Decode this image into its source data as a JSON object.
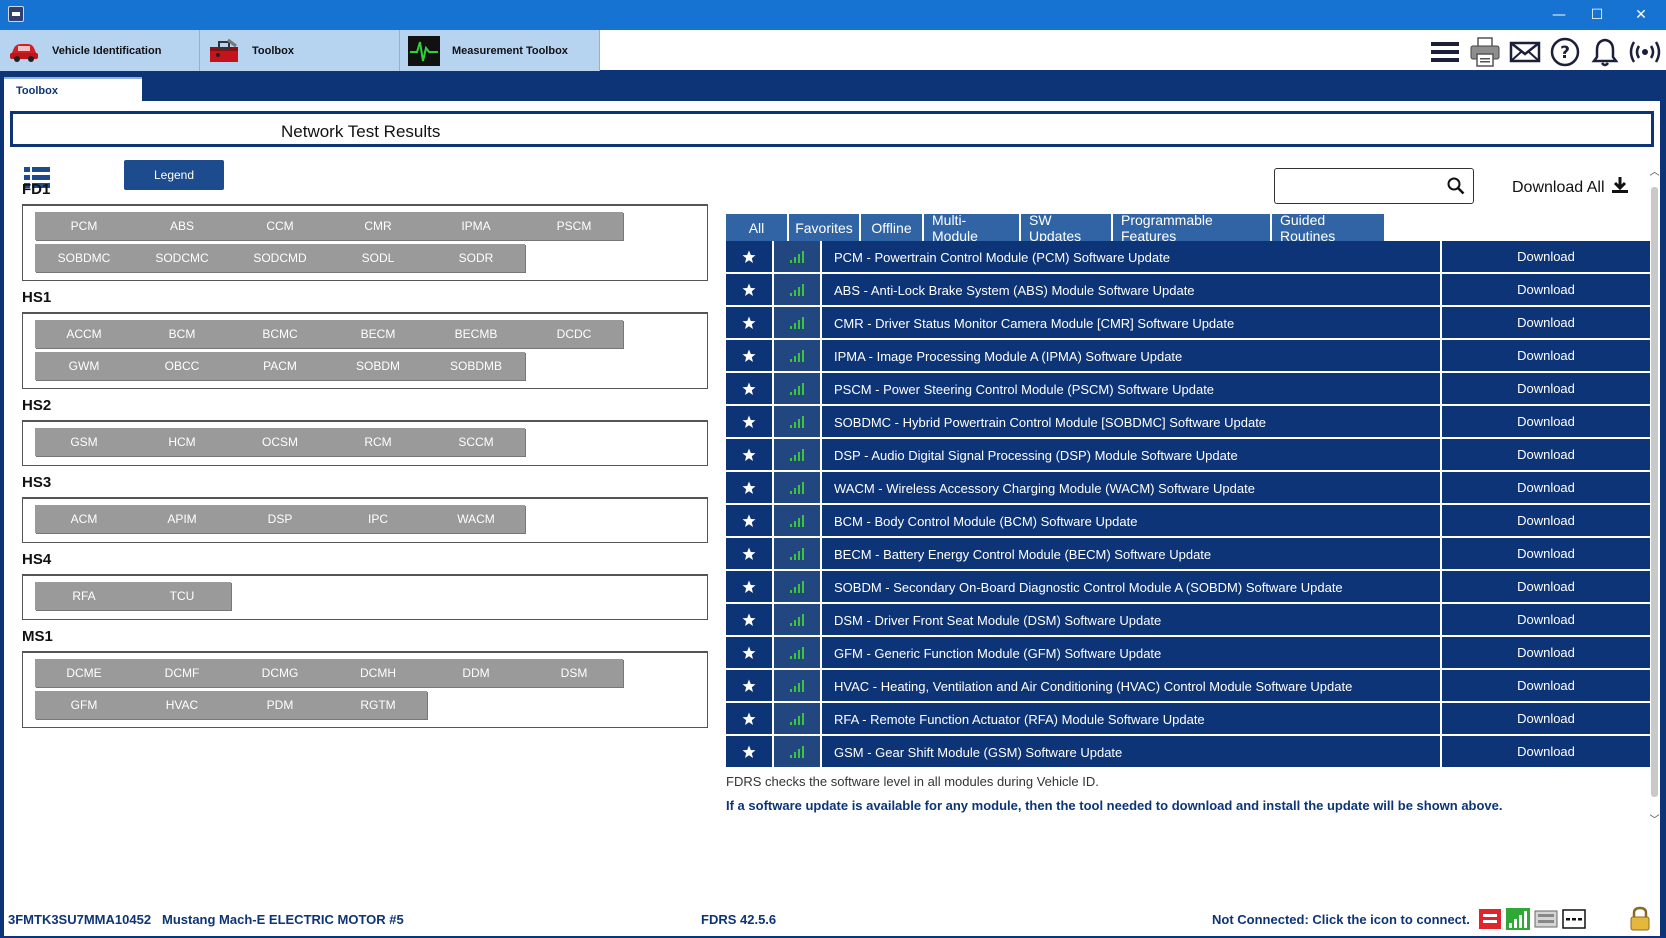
{
  "window": {
    "minimize": "—",
    "maximize": "☐",
    "close": "✕"
  },
  "app_tabs": [
    {
      "label": "Vehicle Identification",
      "icon": "car-icon"
    },
    {
      "label": "Toolbox",
      "icon": "toolbox-icon"
    },
    {
      "label": "Measurement Toolbox",
      "icon": "oscilloscope-icon"
    }
  ],
  "toolbar_icons": [
    "menu-icon",
    "printer-icon",
    "mail-icon",
    "help-icon",
    "bell-icon",
    "wireless-icon"
  ],
  "sub_tab": "Toolbox",
  "page_title": "Network Test Results",
  "legend_label": "Legend",
  "buses": [
    {
      "name": "FD1",
      "modules": [
        "PCM",
        "ABS",
        "CCM",
        "CMR",
        "IPMA",
        "PSCM",
        "SOBDMC",
        "SODCMC",
        "SODCMD",
        "SODL",
        "SODR"
      ]
    },
    {
      "name": "HS1",
      "modules": [
        "ACCM",
        "BCM",
        "BCMC",
        "BECM",
        "BECMB",
        "DCDC",
        "GWM",
        "OBCC",
        "PACM",
        "SOBDM",
        "SOBDMB"
      ]
    },
    {
      "name": "HS2",
      "modules": [
        "GSM",
        "HCM",
        "OCSM",
        "RCM",
        "SCCM"
      ]
    },
    {
      "name": "HS3",
      "modules": [
        "ACM",
        "APIM",
        "DSP",
        "IPC",
        "WACM"
      ]
    },
    {
      "name": "HS4",
      "modules": [
        "RFA",
        "TCU"
      ]
    },
    {
      "name": "MS1",
      "modules": [
        "DCME",
        "DCMF",
        "DCMG",
        "DCMH",
        "DDM",
        "DSM",
        "GFM",
        "HVAC",
        "PDM",
        "RGTM"
      ]
    }
  ],
  "search": {
    "placeholder": "",
    "value": ""
  },
  "download_all": "Download All",
  "filter_tabs": [
    "All",
    "Favorites",
    "Offline",
    "Multi-Module",
    "SW Updates",
    "Programmable Features",
    "Guided Routines"
  ],
  "download_label": "Download",
  "updates": [
    "PCM - Powertrain Control Module (PCM) Software Update",
    "ABS - Anti-Lock Brake System (ABS) Module Software Update",
    "CMR - Driver Status Monitor Camera Module [CMR] Software Update",
    "IPMA - Image Processing Module A (IPMA) Software Update",
    "PSCM - Power Steering Control Module (PSCM) Software Update",
    "SOBDMC - Hybrid Powertrain Control Module [SOBDMC] Software Update",
    "DSP - Audio Digital Signal Processing (DSP) Module Software Update",
    "WACM - Wireless Accessory Charging Module (WACM) Software Update",
    "BCM - Body Control Module (BCM) Software Update",
    "BECM - Battery Energy Control Module (BECM) Software Update",
    "SOBDM - Secondary On-Board Diagnostic Control Module A (SOBDM) Software Update",
    "DSM - Driver Front Seat Module (DSM) Software Update",
    "GFM - Generic Function Module (GFM) Software Update",
    "HVAC - Heating, Ventilation and Air Conditioning (HVAC) Control Module Software Update",
    "RFA - Remote Function Actuator (RFA) Module Software Update",
    "GSM - Gear Shift Module (GSM) Software Update"
  ],
  "notes": {
    "line1": "FDRS checks the software level in all modules during Vehicle ID.",
    "line2": "If a software update is available for any module, then the tool needed to download and install the update will be shown above."
  },
  "status": {
    "vin": "3FMTK3SU7MMA10452",
    "vehicle": "Mustang Mach-E ELECTRIC MOTOR #5",
    "version": "FDRS 42.5.6",
    "connection": "Not Connected: Click the icon to connect."
  },
  "colors": {
    "brand_navy": "#0d3477",
    "title_blue": "#1673d1",
    "tab_light": "#b6d3f0",
    "module_gray": "#9a9a9a",
    "signal_green": "#3cc43c"
  }
}
